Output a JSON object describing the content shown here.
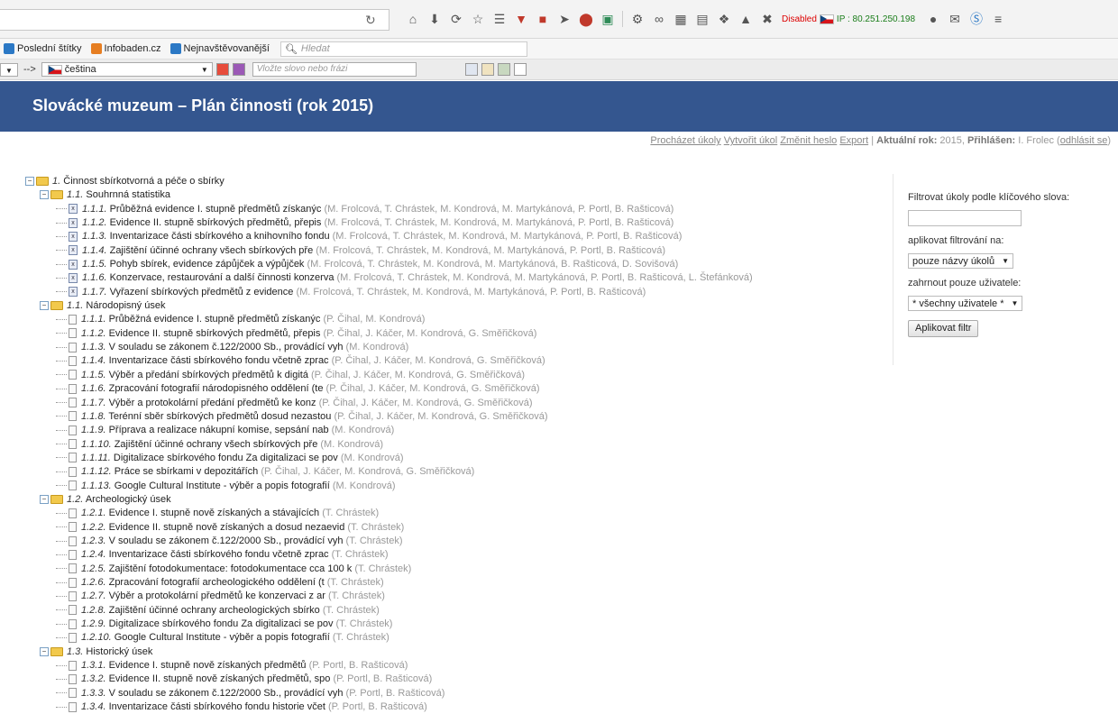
{
  "browser": {
    "toolbar_icons": [
      "reload-icon",
      "home-icon",
      "download-icon",
      "sync-icon",
      "star-icon",
      "reading-list-icon",
      "pocket-icon",
      "addon-icon",
      "send-icon",
      "adblock-icon",
      "addon2-icon",
      "dropdown-icon",
      "gear-icon",
      "glasses-icon",
      "grid-icon",
      "screen-icon",
      "puzzle-icon",
      "rocket-icon",
      "tools-icon"
    ],
    "disabled_label": "Disabled",
    "ip_label": "IP : 80.251.250.198",
    "bookmarks": [
      {
        "label": "Poslední štítky",
        "color": "#2b78c5"
      },
      {
        "label": "Infobaden.cz",
        "color": "#e67e22"
      },
      {
        "label": "Nejnavštěvovanější",
        "color": "#2b78c5"
      }
    ],
    "search_placeholder": "Hledat",
    "arrow_text": "-->",
    "language": "čeština",
    "phrase_placeholder": "Vložte slovo nebo frázi"
  },
  "header": {
    "title": "Slovácké muzeum – Plán činnosti (rok 2015)"
  },
  "topnav": {
    "links": [
      "Procházet úkoly",
      "Vytvořit úkol",
      "Změnit heslo",
      "Export"
    ],
    "year_label": "Aktuální rok:",
    "year": "2015,",
    "user_label": "Přihlášen:",
    "user": "I. Frolec",
    "logout": "odhlásit se"
  },
  "tree": [
    {
      "level": 1,
      "type": "folder",
      "num": "1.",
      "title": "Činnost sbírkotvorná a péče o sbírky",
      "people": ""
    },
    {
      "level": 2,
      "type": "folder",
      "num": "1.1.",
      "title": "Souhrnná statistika",
      "people": ""
    },
    {
      "level": 3,
      "type": "filex",
      "num": "1.1.1.",
      "title": "Průběžná evidence I. stupně předmětů získanýc",
      "people": "(M. Frolcová, T. Chrástek, M. Kondrová, M. Martykánová, P. Portl, B. Rašticová)"
    },
    {
      "level": 3,
      "type": "filex",
      "num": "1.1.2.",
      "title": "Evidence II. stupně sbírkových předmětů, přepis",
      "people": "(M. Frolcová, T. Chrástek, M. Kondrová, M. Martykánová, P. Portl, B. Rašticová)"
    },
    {
      "level": 3,
      "type": "filex",
      "num": "1.1.3.",
      "title": "Inventarizace části sbírkového a knihovního fondu",
      "people": "(M. Frolcová, T. Chrástek, M. Kondrová, M. Martykánová, P. Portl, B. Rašticová)"
    },
    {
      "level": 3,
      "type": "filex",
      "num": "1.1.4.",
      "title": "Zajištění účinné ochrany všech sbírkových pře",
      "people": "(M. Frolcová, T. Chrástek, M. Kondrová, M. Martykánová, P. Portl, B. Rašticová)"
    },
    {
      "level": 3,
      "type": "filex",
      "num": "1.1.5.",
      "title": "Pohyb sbírek, evidence zápůjček a výpůjček",
      "people": "(M. Frolcová, T. Chrástek, M. Kondrová, M. Martykánová, B. Rašticová, D. Sovišová)"
    },
    {
      "level": 3,
      "type": "filex",
      "num": "1.1.6.",
      "title": "Konzervace, restaurování a další činnosti konzerva",
      "people": "(M. Frolcová, T. Chrástek, M. Kondrová, M. Martykánová, P. Portl, B. Rašticová, L. Štefánková)"
    },
    {
      "level": 3,
      "type": "filex",
      "num": "1.1.7.",
      "title": "Vyřazení sbírkových předmětů z evidence",
      "people": "(M. Frolcová, T. Chrástek, M. Kondrová, M. Martykánová, P. Portl, B. Rašticová)"
    },
    {
      "level": 2,
      "type": "folder",
      "num": "1.1.",
      "title": "Národopisný úsek",
      "people": ""
    },
    {
      "level": 3,
      "type": "file",
      "num": "1.1.1.",
      "title": "Průběžná evidence I. stupně předmětů získanýc",
      "people": "(P. Čihal, M. Kondrová)"
    },
    {
      "level": 3,
      "type": "file",
      "num": "1.1.2.",
      "title": "Evidence II. stupně sbírkových předmětů, přepis",
      "people": "(P. Čihal, J. Káčer, M. Kondrová, G. Směřičková)"
    },
    {
      "level": 3,
      "type": "file",
      "num": "1.1.3.",
      "title": "V souladu se zákonem č.122/2000 Sb., provádící vyh",
      "people": "(M. Kondrová)"
    },
    {
      "level": 3,
      "type": "file",
      "num": "1.1.4.",
      "title": "Inventarizace části sbírkového fondu včetně zprac",
      "people": "(P. Čihal, J. Káčer, M. Kondrová, G. Směřičková)"
    },
    {
      "level": 3,
      "type": "file",
      "num": "1.1.5.",
      "title": "Výběr a předání sbírkových předmětů k digitá",
      "people": "(P. Čihal, J. Káčer, M. Kondrová, G. Směřičková)"
    },
    {
      "level": 3,
      "type": "file",
      "num": "1.1.6.",
      "title": "Zpracování fotografií národopisného oddělení (te",
      "people": "(P. Čihal, J. Káčer, M. Kondrová, G. Směřičková)"
    },
    {
      "level": 3,
      "type": "file",
      "num": "1.1.7.",
      "title": "Výběr a protokolární předání předmětů ke konz",
      "people": "(P. Čihal, J. Káčer, M. Kondrová, G. Směřičková)"
    },
    {
      "level": 3,
      "type": "file",
      "num": "1.1.8.",
      "title": "Terénní sběr sbírkových předmětů dosud nezastou",
      "people": "(P. Čihal, J. Káčer, M. Kondrová, G. Směřičková)"
    },
    {
      "level": 3,
      "type": "file",
      "num": "1.1.9.",
      "title": "Příprava a realizace nákupní komise, sepsání nab",
      "people": "(M. Kondrová)"
    },
    {
      "level": 3,
      "type": "file",
      "num": "1.1.10.",
      "title": "Zajištění účinné ochrany všech sbírkových pře",
      "people": "(M. Kondrová)"
    },
    {
      "level": 3,
      "type": "file",
      "num": "1.1.11.",
      "title": "Digitalizace sbírkového fondu Za digitalizaci se pov",
      "people": "(M. Kondrová)"
    },
    {
      "level": 3,
      "type": "file",
      "num": "1.1.12.",
      "title": "Práce se sbírkami v depozitářích",
      "people": "(P. Čihal, J. Káčer, M. Kondrová, G. Směřičková)"
    },
    {
      "level": 3,
      "type": "file",
      "num": "1.1.13.",
      "title": "Google Cultural Institute - výběr a popis fotografií",
      "people": "(M. Kondrová)"
    },
    {
      "level": 2,
      "type": "folder",
      "num": "1.2.",
      "title": "Archeologický úsek",
      "people": ""
    },
    {
      "level": 3,
      "type": "file",
      "num": "1.2.1.",
      "title": "Evidence I. stupně nově získaných a stávajících",
      "people": "(T. Chrástek)"
    },
    {
      "level": 3,
      "type": "file",
      "num": "1.2.2.",
      "title": "Evidence II. stupně nově získaných a dosud nezaevid",
      "people": "(T. Chrástek)"
    },
    {
      "level": 3,
      "type": "file",
      "num": "1.2.3.",
      "title": "V souladu se zákonem č.122/2000 Sb., provádící vyh",
      "people": "(T. Chrástek)"
    },
    {
      "level": 3,
      "type": "file",
      "num": "1.2.4.",
      "title": "Inventarizace části sbírkového fondu včetně zprac",
      "people": "(T. Chrástek)"
    },
    {
      "level": 3,
      "type": "file",
      "num": "1.2.5.",
      "title": "Zajištění fotodokumentace: fotodokumentace cca 100 k",
      "people": "(T. Chrástek)"
    },
    {
      "level": 3,
      "type": "file",
      "num": "1.2.6.",
      "title": "Zpracování fotografií archeologického oddělení (t",
      "people": "(T. Chrástek)"
    },
    {
      "level": 3,
      "type": "file",
      "num": "1.2.7.",
      "title": "Výběr a protokolární předmětů ke konzervaci z ar",
      "people": "(T. Chrástek)"
    },
    {
      "level": 3,
      "type": "file",
      "num": "1.2.8.",
      "title": "Zajištění účinné ochrany archeologických sbírko",
      "people": "(T. Chrástek)"
    },
    {
      "level": 3,
      "type": "file",
      "num": "1.2.9.",
      "title": "Digitalizace sbírkového fondu Za digitalizaci se pov",
      "people": "(T. Chrástek)"
    },
    {
      "level": 3,
      "type": "file",
      "num": "1.2.10.",
      "title": "Google Cultural Institute - výběr a popis fotografií",
      "people": "(T. Chrástek)"
    },
    {
      "level": 2,
      "type": "folder",
      "num": "1.3.",
      "title": "Historický úsek",
      "people": ""
    },
    {
      "level": 3,
      "type": "file",
      "num": "1.3.1.",
      "title": "Evidence I. stupně nově získaných předmětů",
      "people": "(P. Portl, B. Rašticová)"
    },
    {
      "level": 3,
      "type": "file",
      "num": "1.3.2.",
      "title": "Evidence II. stupně nově získaných předmětů, spo",
      "people": "(P. Portl, B. Rašticová)"
    },
    {
      "level": 3,
      "type": "file",
      "num": "1.3.3.",
      "title": "V souladu se zákonem č.122/2000 Sb., provádící vyh",
      "people": "(P. Portl, B. Rašticová)"
    },
    {
      "level": 3,
      "type": "file",
      "num": "1.3.4.",
      "title": "Inventarizace části sbírkového fondu historie včet",
      "people": "(P. Portl, B. Rašticová)"
    }
  ],
  "filter": {
    "keyword_label": "Filtrovat úkoly podle klíčového slova:",
    "keyword_value": "",
    "apply_to_label": "aplikovat filtrování na:",
    "apply_to_value": "pouze názvy úkolů",
    "users_label": "zahrnout pouze uživatele:",
    "users_value": "* všechny uživatele *",
    "apply_button": "Aplikovat filtr"
  }
}
